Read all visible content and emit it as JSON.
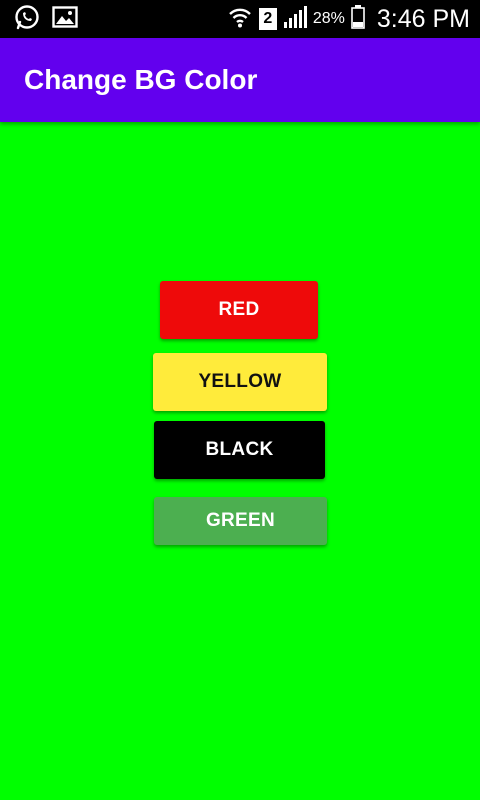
{
  "status_bar": {
    "left_icons": [
      "whatsapp-icon",
      "image-icon"
    ],
    "sim_label": "2",
    "battery_percent": "28%",
    "time": "3:46 PM"
  },
  "app_bar": {
    "title": "Change BG Color",
    "color": "#6200ee"
  },
  "background_color": "#00ff00",
  "buttons": {
    "red": {
      "label": "RED",
      "color": "#ee0a0a"
    },
    "yellow": {
      "label": "YELLOW",
      "color": "#ffeb3b"
    },
    "black": {
      "label": "BLACK",
      "color": "#000000"
    },
    "green": {
      "label": "GREEN",
      "color": "#4caf50"
    }
  }
}
